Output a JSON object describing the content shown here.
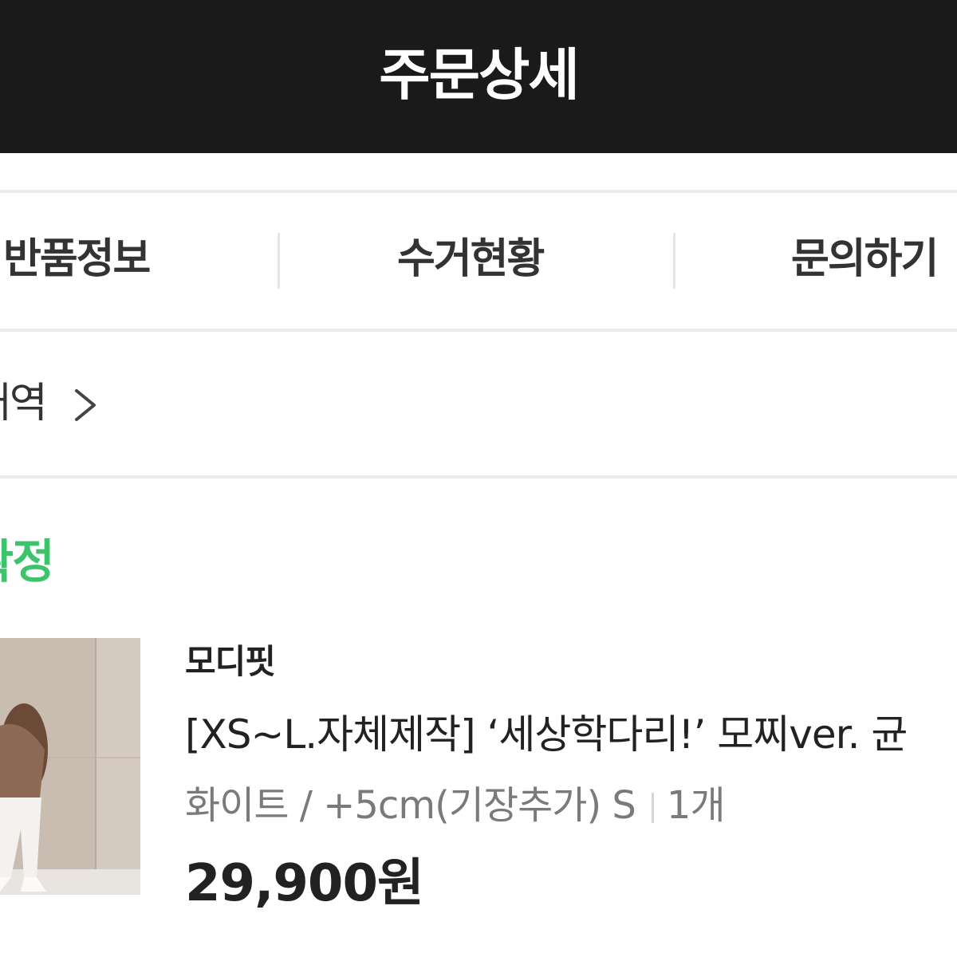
{
  "header": {
    "title": "주문상세"
  },
  "tabs": [
    {
      "label": "반품정보"
    },
    {
      "label": "수거현황"
    },
    {
      "label": "문의하기"
    }
  ],
  "history_link": {
    "label": "내역",
    "icon": "chevron-right-icon"
  },
  "order": {
    "status": "확정",
    "status_color": "#3cc46a",
    "seller": "모디핏",
    "product_name": "[XS~L.자체제작] ‘세상학다리!’ 모찌ver. 균",
    "option": "화이트 / +5cm(기장추가) S",
    "quantity": "1개",
    "price": "29,900원"
  }
}
